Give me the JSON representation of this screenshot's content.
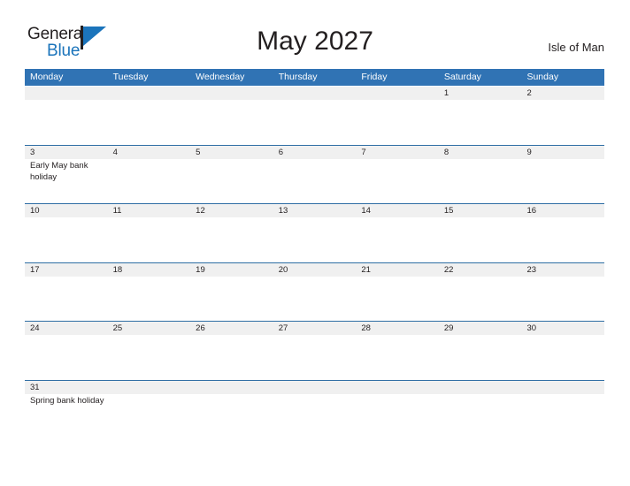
{
  "logo": {
    "text_primary": "General",
    "text_secondary": "Blue",
    "flag_icon": "flag-triangle-icon"
  },
  "header": {
    "title": "May 2027",
    "region": "Isle of Man",
    "month": "May",
    "year": "2027"
  },
  "colors": {
    "header_blue": "#3073b4",
    "rule_blue": "#2e6da4",
    "date_band_gray": "#f0f0f0",
    "logo_blue": "#1b74bb",
    "text_dark": "#231f20",
    "page_background": "#ffffff"
  },
  "weekdays": [
    "Monday",
    "Tuesday",
    "Wednesday",
    "Thursday",
    "Friday",
    "Saturday",
    "Sunday"
  ],
  "weeks": [
    [
      {
        "day": "",
        "event": ""
      },
      {
        "day": "",
        "event": ""
      },
      {
        "day": "",
        "event": ""
      },
      {
        "day": "",
        "event": ""
      },
      {
        "day": "",
        "event": ""
      },
      {
        "day": "1",
        "event": ""
      },
      {
        "day": "2",
        "event": ""
      }
    ],
    [
      {
        "day": "3",
        "event": "Early May bank holiday"
      },
      {
        "day": "4",
        "event": ""
      },
      {
        "day": "5",
        "event": ""
      },
      {
        "day": "6",
        "event": ""
      },
      {
        "day": "7",
        "event": ""
      },
      {
        "day": "8",
        "event": ""
      },
      {
        "day": "9",
        "event": ""
      }
    ],
    [
      {
        "day": "10",
        "event": ""
      },
      {
        "day": "11",
        "event": ""
      },
      {
        "day": "12",
        "event": ""
      },
      {
        "day": "13",
        "event": ""
      },
      {
        "day": "14",
        "event": ""
      },
      {
        "day": "15",
        "event": ""
      },
      {
        "day": "16",
        "event": ""
      }
    ],
    [
      {
        "day": "17",
        "event": ""
      },
      {
        "day": "18",
        "event": ""
      },
      {
        "day": "19",
        "event": ""
      },
      {
        "day": "20",
        "event": ""
      },
      {
        "day": "21",
        "event": ""
      },
      {
        "day": "22",
        "event": ""
      },
      {
        "day": "23",
        "event": ""
      }
    ],
    [
      {
        "day": "24",
        "event": ""
      },
      {
        "day": "25",
        "event": ""
      },
      {
        "day": "26",
        "event": ""
      },
      {
        "day": "27",
        "event": ""
      },
      {
        "day": "28",
        "event": ""
      },
      {
        "day": "29",
        "event": ""
      },
      {
        "day": "30",
        "event": ""
      }
    ],
    [
      {
        "day": "31",
        "event": "Spring bank holiday"
      },
      {
        "day": "",
        "event": ""
      },
      {
        "day": "",
        "event": ""
      },
      {
        "day": "",
        "event": ""
      },
      {
        "day": "",
        "event": ""
      },
      {
        "day": "",
        "event": ""
      },
      {
        "day": "",
        "event": ""
      }
    ]
  ]
}
